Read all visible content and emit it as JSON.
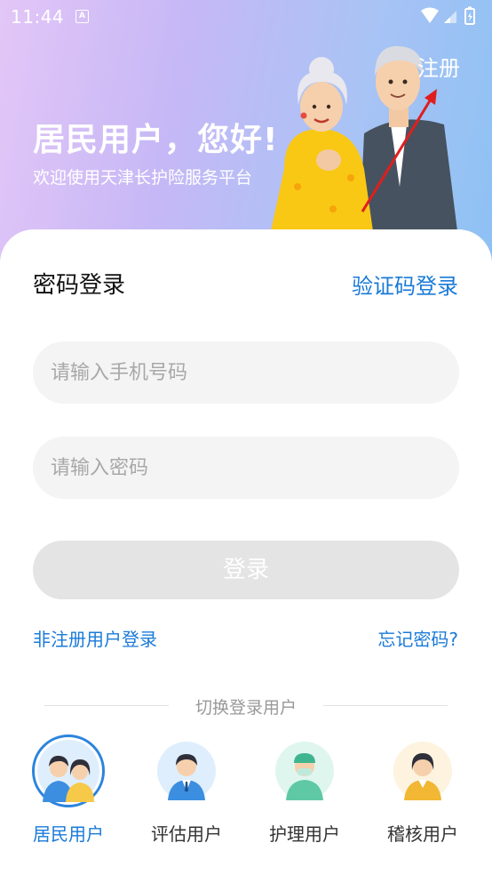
{
  "status_bar": {
    "time": "11:44",
    "notification_badge": "A"
  },
  "header": {
    "title": "居民用户，您好!",
    "subtitle": "欢迎使用天津长护险服务平台",
    "register_label": "注册"
  },
  "login": {
    "mode_title": "密码登录",
    "switch_mode_label": "验证码登录",
    "phone_placeholder": "请输入手机号码",
    "password_placeholder": "请输入密码",
    "submit_label": "登录",
    "guest_login_label": "非注册用户登录",
    "forgot_password_label": "忘记密码?"
  },
  "user_switch": {
    "title": "切换登录用户",
    "types": [
      {
        "label": "居民用户",
        "icon": "resident-avatar-icon",
        "selected": true
      },
      {
        "label": "评估用户",
        "icon": "assessor-avatar-icon",
        "selected": false
      },
      {
        "label": "护理用户",
        "icon": "nurse-avatar-icon",
        "selected": false
      },
      {
        "label": "稽核用户",
        "icon": "auditor-avatar-icon",
        "selected": false
      }
    ]
  },
  "colors": {
    "accent": "#1a7ad8",
    "selected_ring": "#2b84dd",
    "disabled_button": "#e4e4e4",
    "header_gradient_start": "#e3c6f7",
    "header_gradient_end": "#8ec1f4"
  }
}
